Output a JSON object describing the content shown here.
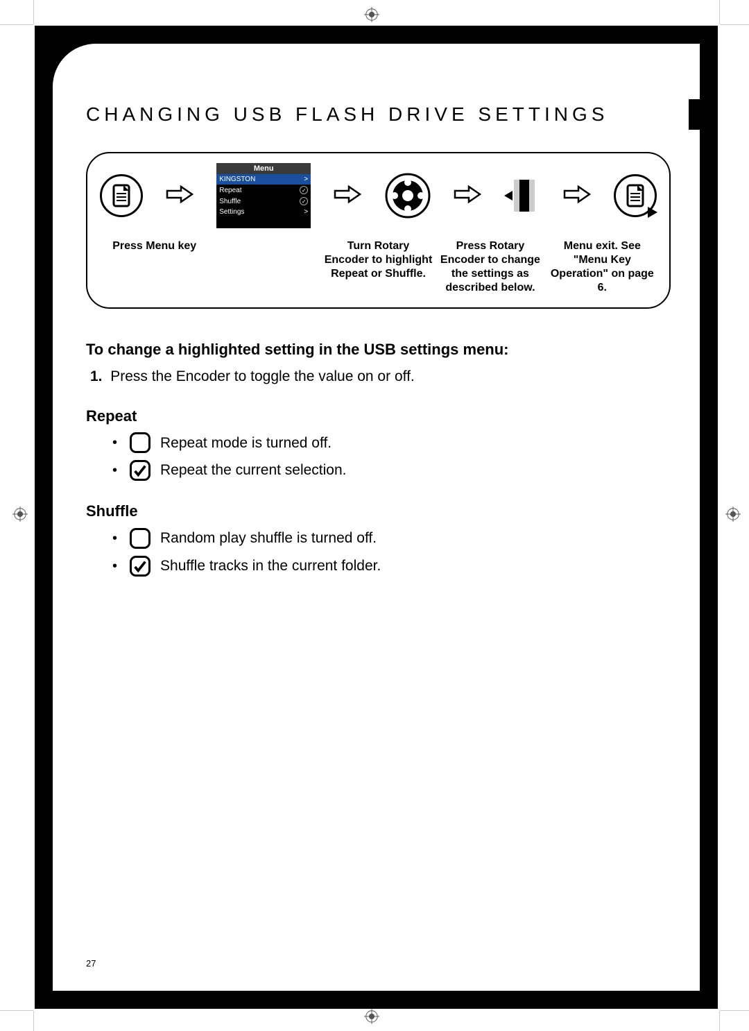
{
  "page_number": "27",
  "section_title": "CHANGING USB FLASH DRIVE SETTINGS",
  "screen": {
    "title": "Menu",
    "rows": [
      {
        "label": "KINGSTON",
        "trail": ">",
        "highlight": true
      },
      {
        "label": "Repeat",
        "trail": "check"
      },
      {
        "label": "Shuffle",
        "trail": "check"
      },
      {
        "label": "Settings",
        "trail": ">"
      }
    ]
  },
  "captions": {
    "c1": "Press Menu key",
    "c2": "",
    "c3": "Turn Rotary Encoder to highlight Repeat or Shuffle.",
    "c4": "Press Rotary Encoder to change the settings as described below.",
    "c5": "Menu exit. See \"Menu Key Operation\" on page 6."
  },
  "sub_heading": "To change a highlighted setting in the USB settings menu:",
  "step1_num": "1.",
  "step1_text": "Press the Encoder to toggle the value on or off.",
  "repeat": {
    "title": "Repeat",
    "off": "Repeat mode is turned off.",
    "on": "Repeat the current selection."
  },
  "shuffle": {
    "title": "Shuffle",
    "off": "Random play shuffle is turned off.",
    "on": "Shuffle tracks in the current folder."
  }
}
